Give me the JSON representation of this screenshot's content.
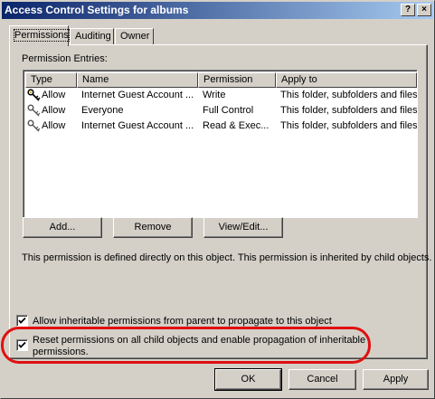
{
  "window": {
    "title": "Access Control Settings for albums",
    "help_label": "?",
    "close_label": "×"
  },
  "tabs": [
    {
      "label": "Permissions",
      "active": true
    },
    {
      "label": "Auditing",
      "active": false
    },
    {
      "label": "Owner",
      "active": false
    }
  ],
  "permissions": {
    "entries_label": "Permission Entries:",
    "columns": [
      "Type",
      "Name",
      "Permission",
      "Apply to"
    ],
    "rows": [
      {
        "icon": "key-icon",
        "type": "Allow",
        "name": "Internet Guest Account ...",
        "permission": "Write",
        "apply_to": "This folder, subfolders and files"
      },
      {
        "icon": "key-icon",
        "type": "Allow",
        "name": "Everyone",
        "permission": "Full Control",
        "apply_to": "This folder, subfolders and files"
      },
      {
        "icon": "key-icon",
        "type": "Allow",
        "name": "Internet Guest Account ...",
        "permission": "Read & Exec...",
        "apply_to": "This folder, subfolders and files"
      }
    ],
    "add_label": "Add...",
    "remove_label": "Remove",
    "view_edit_label": "View/Edit...",
    "info_text": "This permission is defined directly on this object. This permission is inherited by child objects.",
    "inherit_label": "Allow inheritable permissions from parent to propagate to this object",
    "inherit_checked": true,
    "reset_label_line1": "Reset permissions on all child objects and enable propagation of inheritable",
    "reset_label_line2": "permissions.",
    "reset_checked": true
  },
  "footer": {
    "ok_label": "OK",
    "cancel_label": "Cancel",
    "apply_label": "Apply"
  },
  "colors": {
    "title_gradient_start": "#0a246a",
    "title_gradient_end": "#a6caf0",
    "dialog_face": "#d4d0c8",
    "annotation": "#e01010"
  }
}
